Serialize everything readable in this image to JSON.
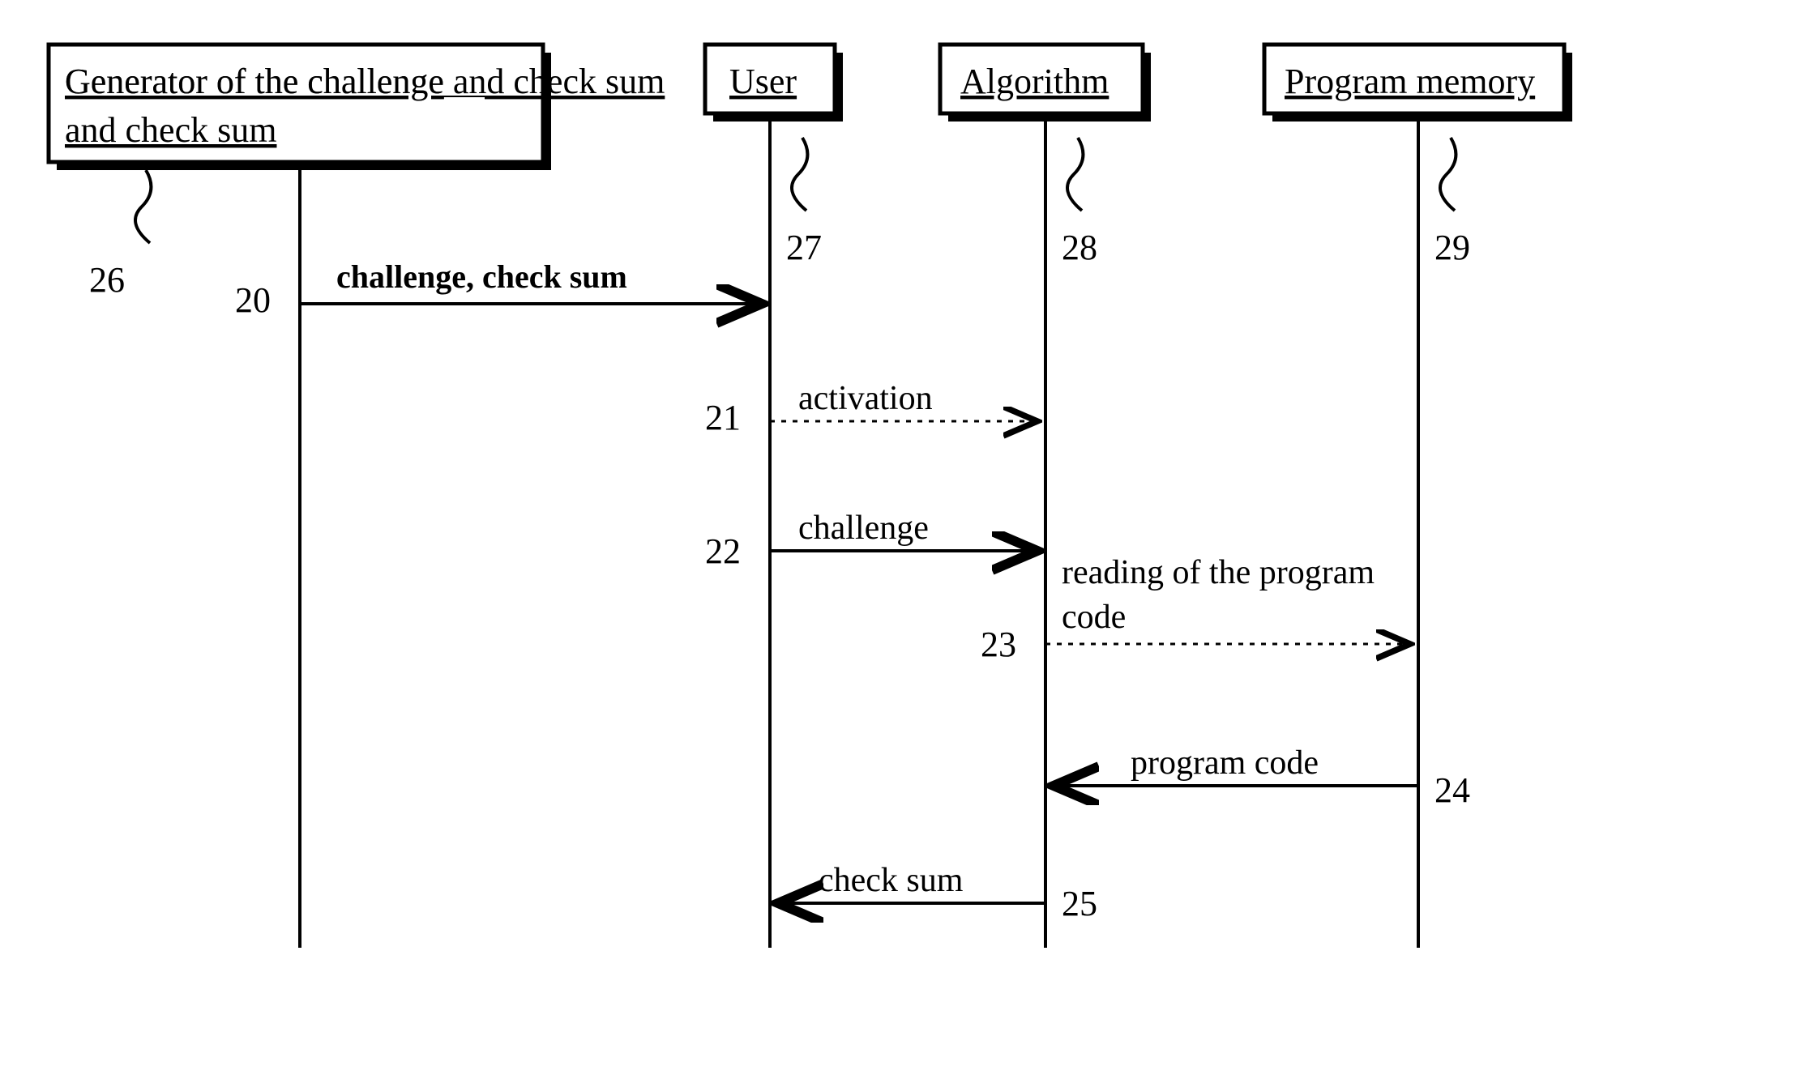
{
  "participants": {
    "generator": "Generator of the challenge and check sum",
    "user": "User",
    "algorithm": "Algorithm",
    "memory": "Program memory"
  },
  "pointer_refs": {
    "generator": "26",
    "user": "27",
    "algorithm": "28",
    "memory": "29"
  },
  "messages": {
    "m20": {
      "num": "20",
      "text": "challenge, check sum"
    },
    "m21": {
      "num": "21",
      "text": "activation"
    },
    "m22": {
      "num": "22",
      "text": "challenge"
    },
    "m23": {
      "num": "23",
      "text": "reading of the program code"
    },
    "m24": {
      "num": "24",
      "text": "program code"
    },
    "m25": {
      "num": "25",
      "text": "check sum"
    }
  }
}
